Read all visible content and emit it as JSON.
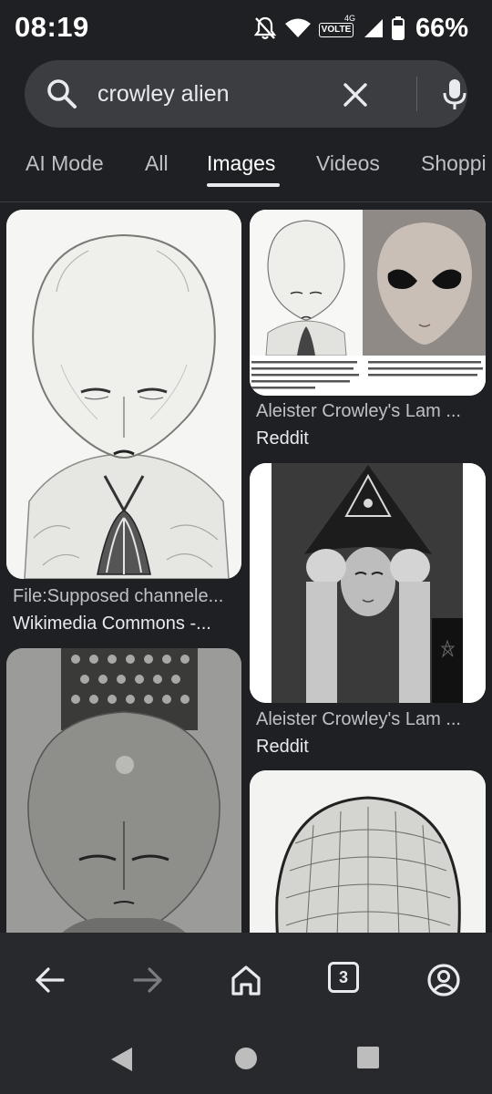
{
  "status_bar": {
    "time": "08:19",
    "network_label": "VOLTE",
    "network_gen": "4G",
    "battery": "66%"
  },
  "search": {
    "query": "crowley alien"
  },
  "tabs": [
    {
      "label": "AI Mode",
      "active": false
    },
    {
      "label": "All",
      "active": false
    },
    {
      "label": "Images",
      "active": true
    },
    {
      "label": "Videos",
      "active": false
    },
    {
      "label": "Shoppi",
      "active": false
    }
  ],
  "results": [
    {
      "title": "File:Supposed channele...",
      "source": "Wikimedia Commons -...",
      "subject": "lam drawing"
    },
    {
      "title": "Aleister Crowley's Lam ...",
      "source": "Reddit",
      "subject": "lam vs grey alien"
    },
    {
      "title": "Aleister Crowley's Lam ...",
      "source": "Reddit",
      "subject": "crowley portrait"
    },
    {
      "title": "",
      "source": "",
      "subject": "lam painting"
    },
    {
      "title": "",
      "source": "",
      "subject": "lam sketch"
    }
  ],
  "comparison_captions": {
    "left": "The demon known to Aleister Crowley as \"Lam\" and evoked by him through \"sex magick\" while performing what he called his \"Amalantrah Workings\" in New York City in 1918. The drawing is by Crowley himself.",
    "right": "Standard depiction of what's known as an \"alien grey.\" The drawing above comes from the cover of Whitley Strieber's book \"Communion.\""
  },
  "browser_bar": {
    "tab_count": "3"
  },
  "colors": {
    "background": "#1f2023",
    "search_bg": "#3c3d40",
    "bar_bg": "#28292c",
    "text_primary": "#e8eaed",
    "text_secondary": "#bdc1c6"
  }
}
